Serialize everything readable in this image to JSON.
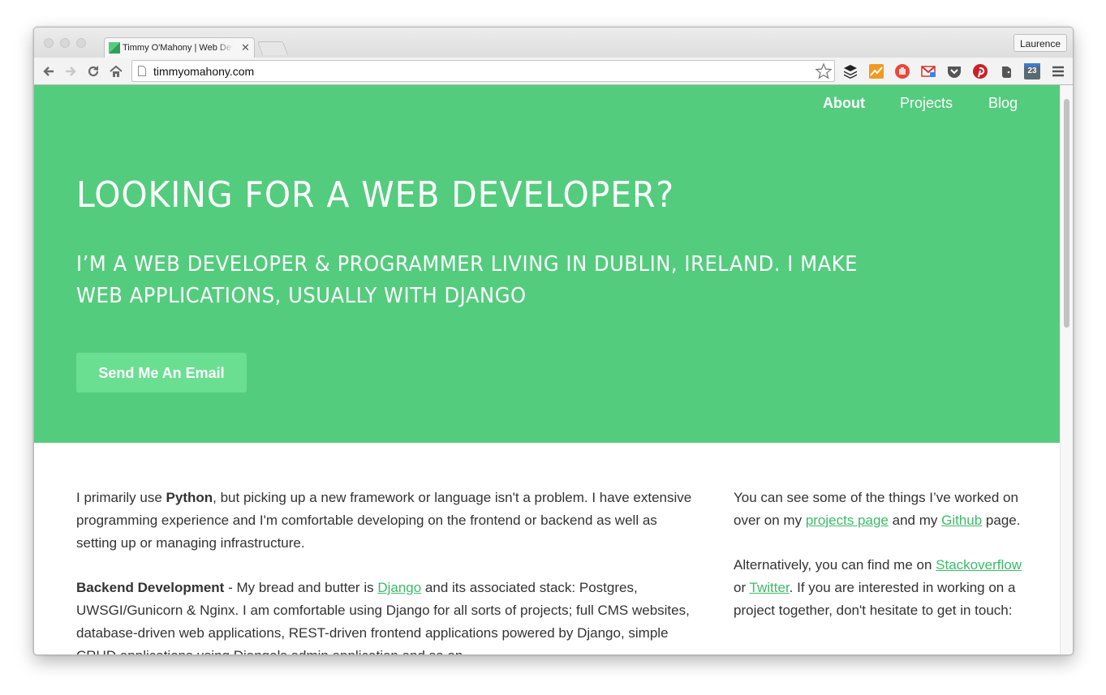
{
  "browser": {
    "tab_title": "Timmy O'Mahony | Web Developer",
    "profile_name": "Laurence",
    "url": "timmyomahony.com",
    "calendar_day": "23"
  },
  "nav": {
    "about": "About",
    "projects": "Projects",
    "blog": "Blog"
  },
  "hero": {
    "headline": "LOOKING FOR A WEB DEVELOPER?",
    "subheadline": "I’M A WEB DEVELOPER & PROGRAMMER LIVING IN DUBLIN, IRELAND. I MAKE WEB APPLICATIONS, USUALLY WITH DJANGO",
    "cta": "Send Me An Email"
  },
  "main": {
    "p1_a": "I primarily use ",
    "p1_python": "Python",
    "p1_b": ", but picking up a new framework or language isn't a problem. I have extensive programming experience and I'm comfortable developing on the frontend or backend as well as setting up or managing infrastructure.",
    "p2_heading": "Backend Development",
    "p2_a": " - My bread and butter is ",
    "p2_django": "Django",
    "p2_b": " and its associated stack: Postgres, UWSGI/Gunicorn & Nginx. I am comfortable using Django for all sorts of projects; full CMS websites, database-driven web applications, REST-driven frontend applications powered by Django, simple CRUD applications using Djangols admin application and so on."
  },
  "side": {
    "s1_a": "You can see some of the things I’ve worked on over on my ",
    "s1_projects": "projects page",
    "s1_b": " and my ",
    "s1_github": "Github",
    "s1_c": " page.",
    "s2_a": "Alternatively, you can find me on ",
    "s2_stackoverflow": "Stackoverflow",
    "s2_b": " or ",
    "s2_twitter": "Twitter",
    "s2_c": ". If you are interested in working on a project together, don't hesitate to get in touch:"
  },
  "colors": {
    "hero_green": "#54cc7e",
    "button_green": "#6adf92",
    "link_green": "#3dba6a"
  }
}
